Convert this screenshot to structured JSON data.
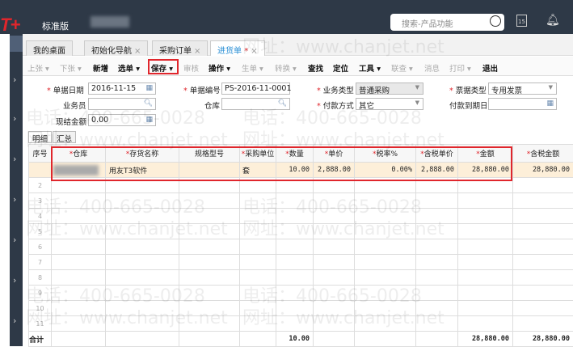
{
  "header": {
    "logo": "T+",
    "edition": "标准版",
    "search_placeholder": "搜索-产品功能",
    "calendar_day": "15"
  },
  "tabs": [
    {
      "label": "我的桌面"
    },
    {
      "label": "初始化导航"
    },
    {
      "label": "采购订单"
    },
    {
      "label": "进货单",
      "modified": "*"
    }
  ],
  "toolbar": [
    "上张 ▾",
    "下张 ▾",
    "新增",
    "选单 ▾",
    "保存 ▾",
    "审核",
    "操作 ▾",
    "生单 ▾",
    "转换 ▾",
    "查找",
    "定位",
    "工具 ▾",
    "联查 ▾",
    "消息",
    "打印 ▾",
    "退出"
  ],
  "form": {
    "date_label": "单据日期",
    "date": "2016-11-15",
    "code_label": "单据编号",
    "code": "PS-2016-11-0001",
    "biz_type_label": "业务类型",
    "biz_type": "普通采购",
    "invoice_type_label": "票据类型",
    "invoice_type": "专用发票",
    "clerk_label": "业务员",
    "clerk": "",
    "warehouse_label": "仓库",
    "warehouse": "",
    "pay_method_label": "付款方式",
    "pay_method": "其它",
    "due_date_label": "付款到期日",
    "due_date": "",
    "cash_label": "现结金额",
    "cash": "0.00"
  },
  "detail_tabs": [
    "明细",
    "汇总"
  ],
  "table": {
    "columns": [
      "序号",
      "仓库",
      "存货名称",
      "规格型号",
      "采购单位",
      "数量",
      "单价",
      "税率%",
      "含税单价",
      "金额",
      "含税金额"
    ],
    "rows": [
      {
        "no": "",
        "warehouse": "",
        "name": "用友T3软件",
        "spec": "",
        "unit": "套",
        "qty": "10.00",
        "price": "2,888.00",
        "tax": "0.00%",
        "tax_price": "2,888.00",
        "amount": "28,880.00",
        "tax_amount": "28,880.00"
      }
    ],
    "row_numbers": [
      "2",
      "3",
      "4",
      "5",
      "6",
      "7",
      "8",
      "9",
      "10",
      "11"
    ],
    "total": {
      "label": "合计",
      "qty": "10.00",
      "amount": "28,880.00",
      "tax_amount": "28,880.00"
    }
  },
  "watermark": {
    "phone": "电话：400-665-0028",
    "site": "网址：www.chanjet.net"
  }
}
